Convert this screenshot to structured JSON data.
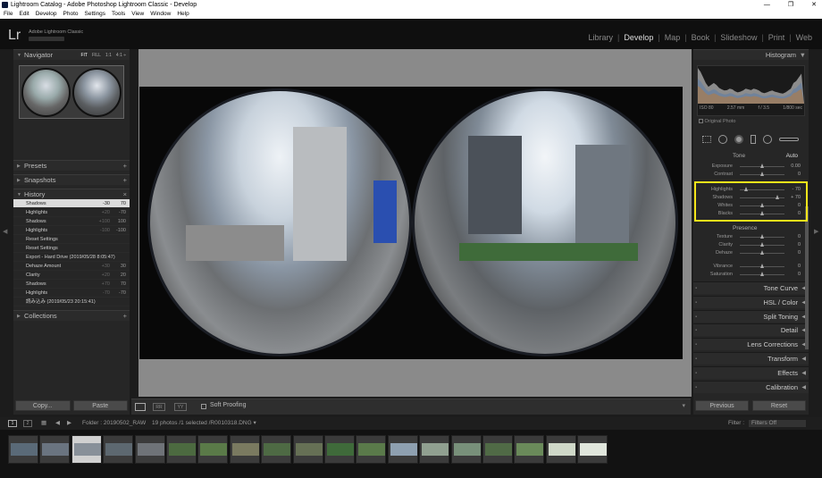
{
  "window": {
    "title": "Lightroom Catalog - Adobe Photoshop Lightroom Classic - Develop",
    "controls": [
      "—",
      "❐",
      "✕"
    ]
  },
  "menu": [
    "File",
    "Edit",
    "Develop",
    "Photo",
    "Settings",
    "Tools",
    "View",
    "Window",
    "Help"
  ],
  "brand": {
    "logo": "Lr",
    "product": "Adobe Lightroom Classic"
  },
  "modules": [
    {
      "label": "Library",
      "active": false
    },
    {
      "label": "Develop",
      "active": true
    },
    {
      "label": "Map",
      "active": false
    },
    {
      "label": "Book",
      "active": false
    },
    {
      "label": "Slideshow",
      "active": false
    },
    {
      "label": "Print",
      "active": false
    },
    {
      "label": "Web",
      "active": false
    }
  ],
  "left": {
    "navigator": {
      "title": "Navigator",
      "options": [
        "FIT",
        "FILL",
        "1:1",
        "4:1 ÷"
      ]
    },
    "presets": {
      "title": "Presets"
    },
    "snapshots": {
      "title": "Snapshots"
    },
    "history": {
      "title": "History",
      "items": [
        {
          "label": "Shadows",
          "v1": "-30",
          "v2": "70"
        },
        {
          "label": "Highlights",
          "v1": "+20",
          "v2": "-70"
        },
        {
          "label": "Shadows",
          "v1": "+100",
          "v2": "100"
        },
        {
          "label": "Highlights",
          "v1": "-100",
          "v2": "-100"
        },
        {
          "label": "Reset Settings",
          "v1": "",
          "v2": ""
        },
        {
          "label": "Reset Settings",
          "v1": "",
          "v2": ""
        },
        {
          "label": "Export - Hard Drive (2019/05/28 8:05:47)",
          "v1": "",
          "v2": ""
        },
        {
          "label": "Dehaze Amount",
          "v1": "+30",
          "v2": "30"
        },
        {
          "label": "Clarity",
          "v1": "+20",
          "v2": "20"
        },
        {
          "label": "Shadows",
          "v1": "+70",
          "v2": "70"
        },
        {
          "label": "Highlights",
          "v1": "-70",
          "v2": "-70"
        },
        {
          "label": "読み込み (2019/05/23 20:15:41)",
          "v1": "",
          "v2": ""
        }
      ]
    },
    "collections": {
      "title": "Collections"
    },
    "copy_label": "Copy...",
    "paste_label": "Paste"
  },
  "toolbar": {
    "soft_proofing": "Soft Proofing"
  },
  "right": {
    "histogram": {
      "title": "Histogram",
      "info": [
        "ISO 80",
        "2.57 mm",
        "f / 3.5",
        "1/800 sec"
      ],
      "original_photo": "Original Photo",
      "bars": [
        0.95,
        0.85,
        0.7,
        0.55,
        0.45,
        0.5,
        0.55,
        0.5,
        0.42,
        0.38,
        0.35,
        0.36,
        0.4,
        0.38,
        0.33,
        0.3,
        0.32,
        0.35,
        0.4,
        0.38,
        0.36,
        0.4,
        0.38,
        0.35,
        0.3,
        0.28,
        0.3,
        0.33,
        0.35,
        0.32,
        0.3,
        0.28,
        0.27,
        0.3,
        0.35,
        0.4,
        0.55,
        0.6,
        0.7,
        0.8
      ]
    },
    "tone": {
      "label": "Tone",
      "auto": "Auto"
    },
    "sliders": [
      {
        "label": "Exposure",
        "value": "0.00",
        "pos": 0.5
      },
      {
        "label": "Contrast",
        "value": "0",
        "pos": 0.5
      },
      {
        "label": "Highlights",
        "value": "- 70",
        "pos": 0.15
      },
      {
        "label": "Shadows",
        "value": "+ 70",
        "pos": 0.85
      },
      {
        "label": "Whites",
        "value": "0",
        "pos": 0.5
      },
      {
        "label": "Blacks",
        "value": "0",
        "pos": 0.5
      }
    ],
    "presence": {
      "label": "Presence"
    },
    "presence_sliders": [
      {
        "label": "Texture",
        "value": "0",
        "pos": 0.5
      },
      {
        "label": "Clarity",
        "value": "0",
        "pos": 0.5
      },
      {
        "label": "Dehaze",
        "value": "0",
        "pos": 0.5
      },
      {
        "label": "Vibrance",
        "value": "0",
        "pos": 0.5
      },
      {
        "label": "Saturation",
        "value": "0",
        "pos": 0.5
      }
    ],
    "sections": [
      "Tone Curve",
      "HSL / Color",
      "Split Toning",
      "Detail",
      "Lens Corrections",
      "Transform",
      "Effects",
      "Calibration"
    ],
    "previous_label": "Previous",
    "reset_label": "Reset"
  },
  "filmbar": {
    "pages": [
      "1",
      "2"
    ],
    "folder": "Folder : 20190502_RAW",
    "count": "19 photos /1 selected /R0010318.DNG ▾",
    "filter_label": "Filter :",
    "filter_value": "Filters Off"
  },
  "filmstrip": {
    "selected_index": 2,
    "count": 19
  }
}
